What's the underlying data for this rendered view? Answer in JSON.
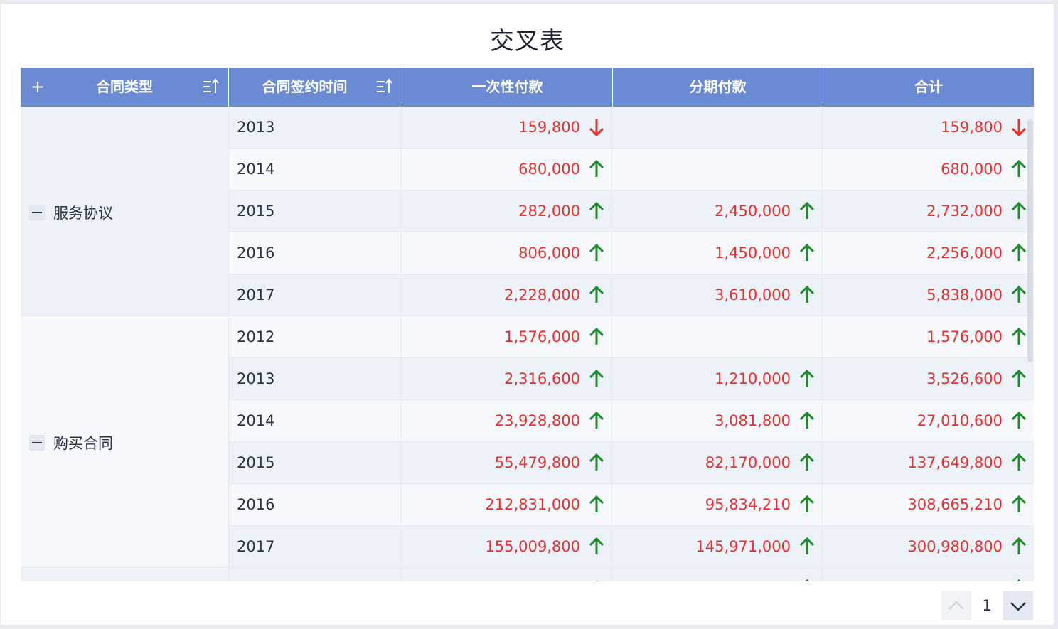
{
  "title": "交叉表",
  "headers": {
    "expand_all": "+",
    "contract_type": "合同类型",
    "sign_time": "合同签约时间",
    "one_time": "一次性付款",
    "installment": "分期付款",
    "total": "合计"
  },
  "groups": [
    {
      "label": "服务协议",
      "rows": [
        {
          "year": "2013",
          "one_time": "159,800",
          "one_time_trend": "down",
          "installment": "",
          "installment_trend": "",
          "total": "159,800",
          "total_trend": "down"
        },
        {
          "year": "2014",
          "one_time": "680,000",
          "one_time_trend": "up",
          "installment": "",
          "installment_trend": "",
          "total": "680,000",
          "total_trend": "up"
        },
        {
          "year": "2015",
          "one_time": "282,000",
          "one_time_trend": "up",
          "installment": "2,450,000",
          "installment_trend": "up",
          "total": "2,732,000",
          "total_trend": "up"
        },
        {
          "year": "2016",
          "one_time": "806,000",
          "one_time_trend": "up",
          "installment": "1,450,000",
          "installment_trend": "up",
          "total": "2,256,000",
          "total_trend": "up"
        },
        {
          "year": "2017",
          "one_time": "2,228,000",
          "one_time_trend": "up",
          "installment": "3,610,000",
          "installment_trend": "up",
          "total": "5,838,000",
          "total_trend": "up"
        }
      ]
    },
    {
      "label": "购买合同",
      "rows": [
        {
          "year": "2012",
          "one_time": "1,576,000",
          "one_time_trend": "up",
          "installment": "",
          "installment_trend": "",
          "total": "1,576,000",
          "total_trend": "up"
        },
        {
          "year": "2013",
          "one_time": "2,316,600",
          "one_time_trend": "up",
          "installment": "1,210,000",
          "installment_trend": "up",
          "total": "3,526,600",
          "total_trend": "up"
        },
        {
          "year": "2014",
          "one_time": "23,928,800",
          "one_time_trend": "up",
          "installment": "3,081,800",
          "installment_trend": "up",
          "total": "27,010,600",
          "total_trend": "up"
        },
        {
          "year": "2015",
          "one_time": "55,479,800",
          "one_time_trend": "up",
          "installment": "82,170,000",
          "installment_trend": "up",
          "total": "137,649,800",
          "total_trend": "up"
        },
        {
          "year": "2016",
          "one_time": "212,831,000",
          "one_time_trend": "up",
          "installment": "95,834,210",
          "installment_trend": "up",
          "total": "308,665,210",
          "total_trend": "up"
        },
        {
          "year": "2017",
          "one_time": "155,009,800",
          "one_time_trend": "up",
          "installment": "145,971,000",
          "installment_trend": "up",
          "total": "300,980,800",
          "total_trend": "up"
        }
      ]
    }
  ],
  "partial_row": {
    "one_time_trend": "down",
    "installment_trend": "up",
    "total_trend": "up"
  },
  "pagination": {
    "current_page": "1"
  },
  "colors": {
    "header_bg": "#6a8bd3",
    "value_red": "#e8312f",
    "arrow_up_green": "#1f8a2e",
    "arrow_down_red": "#e8312f",
    "row_alt_a": "#edf1f8",
    "row_alt_b": "#f6f8fc"
  },
  "icons": {
    "sort": "sort-ascending-icon",
    "collapse": "collapse-minus-icon",
    "expand": "expand-plus-icon",
    "pager_up": "chevron-up-icon",
    "pager_down": "chevron-down-icon"
  }
}
